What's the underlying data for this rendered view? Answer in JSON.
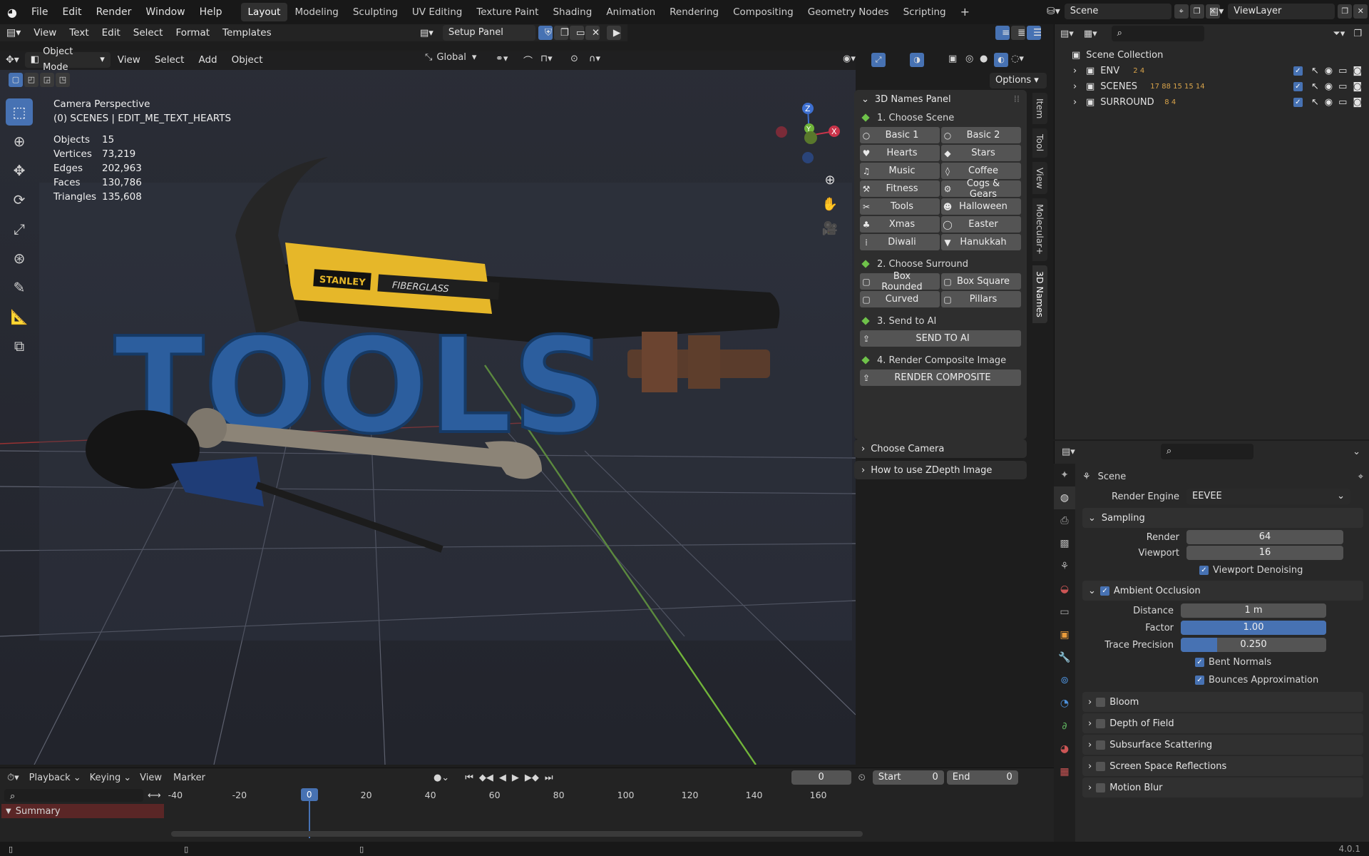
{
  "topbar": {
    "menus": [
      "File",
      "Edit",
      "Render",
      "Window",
      "Help"
    ],
    "workspaces": [
      "Layout",
      "Modeling",
      "Sculpting",
      "UV Editing",
      "Texture Paint",
      "Shading",
      "Animation",
      "Rendering",
      "Compositing",
      "Geometry Nodes",
      "Scripting"
    ],
    "active_workspace": "Layout",
    "scene": "Scene",
    "view_layer": "ViewLayer"
  },
  "text_editor": {
    "menus": [
      "View",
      "Text",
      "Edit",
      "Select",
      "Format",
      "Templates"
    ],
    "file": "Setup Panel"
  },
  "viewport": {
    "mode": "Object Mode",
    "menus": [
      "View",
      "Select",
      "Add",
      "Object"
    ],
    "orientation": "Global",
    "options": "Options",
    "camera": "Camera Perspective",
    "context": "(0) SCENES | EDIT_ME_TEXT_HEARTS",
    "stats": [
      {
        "k": "Objects",
        "v": "15"
      },
      {
        "k": "Vertices",
        "v": "73,219"
      },
      {
        "k": "Edges",
        "v": "202,963"
      },
      {
        "k": "Faces",
        "v": "130,786"
      },
      {
        "k": "Triangles",
        "v": "135,608"
      }
    ],
    "scene_text": "TOOLS",
    "hammer_brand": "STANLEY",
    "hammer_handle": "FIBERGLASS",
    "gizmo": {
      "x": "X",
      "y": "Y",
      "z": "Z"
    }
  },
  "npanel": {
    "title": "3D Names Panel",
    "s1": "1. Choose Scene",
    "scenes": [
      {
        "i": "○",
        "t": "Basic 1"
      },
      {
        "i": "○",
        "t": "Basic 2"
      },
      {
        "i": "♥",
        "t": "Hearts"
      },
      {
        "i": "◆",
        "t": "Stars"
      },
      {
        "i": "♫",
        "t": "Music"
      },
      {
        "i": "◊",
        "t": "Coffee"
      },
      {
        "i": "⚒",
        "t": "Fitness"
      },
      {
        "i": "⚙",
        "t": "Cogs & Gears"
      },
      {
        "i": "✂",
        "t": "Tools"
      },
      {
        "i": "☻",
        "t": "Halloween"
      },
      {
        "i": "♣",
        "t": "Xmas"
      },
      {
        "i": "◯",
        "t": "Easter"
      },
      {
        "i": "⁞",
        "t": "Diwali"
      },
      {
        "i": "▼",
        "t": "Hanukkah"
      }
    ],
    "s2": "2. Choose Surround",
    "surrounds": [
      {
        "i": "▢",
        "t": "Box Rounded"
      },
      {
        "i": "▢",
        "t": "Box Square"
      },
      {
        "i": "▢",
        "t": "Curved"
      },
      {
        "i": "▢",
        "t": "Pillars"
      }
    ],
    "s3": "3. Send to AI",
    "send": "SEND TO AI",
    "s4": "4. Render Composite Image",
    "render": "RENDER COMPOSITE",
    "choose_camera": "Choose Camera",
    "zdepth": "How to use ZDepth Image",
    "tabs": [
      "Item",
      "Tool",
      "View",
      "Molecular+",
      "3D Names"
    ]
  },
  "outliner": {
    "root": "Scene Collection",
    "items": [
      {
        "name": "ENV",
        "badges": "2  4"
      },
      {
        "name": "SCENES",
        "badges": "17  88  15  15  14"
      },
      {
        "name": "SURROUND",
        "badges": "8  4"
      }
    ]
  },
  "properties": {
    "scene": "Scene",
    "render_engine_label": "Render Engine",
    "render_engine": "EEVEE",
    "sampling": "Sampling",
    "render_label": "Render",
    "render_val": "64",
    "viewport_label": "Viewport",
    "viewport_val": "16",
    "denoise": "Viewport Denoising",
    "ao": "Ambient Occlusion",
    "distance_label": "Distance",
    "distance": "1 m",
    "factor_label": "Factor",
    "factor": "1.00",
    "factor_fill": 1.0,
    "trace_label": "Trace Precision",
    "trace": "0.250",
    "trace_fill": 0.25,
    "bent": "Bent Normals",
    "bounces": "Bounces Approximation",
    "sections": [
      "Bloom",
      "Depth of Field",
      "Subsurface Scattering",
      "Screen Space Reflections",
      "Motion Blur"
    ]
  },
  "timeline": {
    "menus": [
      "Playback",
      "Keying",
      "View",
      "Marker"
    ],
    "frame": "0",
    "start_label": "Start",
    "start": "0",
    "end_label": "End",
    "end": "0",
    "current": "0",
    "ticks": [
      "-40",
      "-20",
      "20",
      "40",
      "60",
      "80",
      "100",
      "120",
      "140",
      "160"
    ],
    "summary": "Summary"
  },
  "status": {
    "version": "4.0.1"
  }
}
